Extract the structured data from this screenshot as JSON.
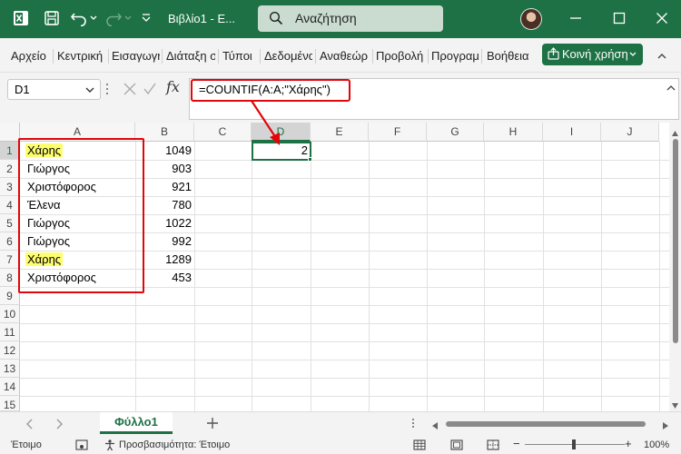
{
  "titlebar": {
    "doc_title": "Βιβλίο1 - Ε...",
    "search_placeholder": "Αναζήτηση",
    "bg": "#1e7145"
  },
  "menu": {
    "items": [
      "Αρχείο",
      "Κεντρική",
      "Εισαγωγή",
      "Διάταξη σ",
      "Τύποι",
      "Δεδομένα",
      "Αναθεώρ",
      "Προβολή",
      "Προγραμ",
      "Βοήθεια"
    ],
    "share_label": "Κοινή χρήση"
  },
  "formula_bar": {
    "name_box": "D1",
    "fx_label": "fx",
    "formula": "=COUNTIF(A:A;\"Χάρης\")"
  },
  "grid": {
    "columns": [
      "A",
      "B",
      "C",
      "D",
      "E",
      "F",
      "G",
      "H",
      "I",
      "J"
    ],
    "rows": [
      "1",
      "2",
      "3",
      "4",
      "5",
      "6",
      "7",
      "8",
      "9",
      "10",
      "11",
      "12",
      "13",
      "14",
      "15"
    ],
    "col_a": [
      "Χάρης",
      "Γιώργος",
      "Χριστόφορος",
      "Έλενα",
      "Γιώργος",
      "Γιώργος",
      "Χάρης",
      "Χριστόφορος"
    ],
    "col_b": [
      "1049",
      "903",
      "921",
      "780",
      "1022",
      "992",
      "1289",
      "453"
    ],
    "d1": "2",
    "highlight_color": "#fdfd70",
    "annotation_color": "#e0060a"
  },
  "sheets": {
    "active": "Φύλλο1"
  },
  "status": {
    "ready": "Έτοιμο",
    "accessibility": "Προσβασιμότητα: Έτοιμο",
    "zoom": "100%"
  }
}
